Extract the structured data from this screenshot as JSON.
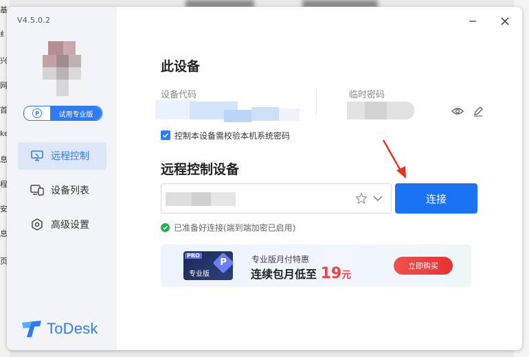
{
  "app": {
    "version": "V4.5.0.2",
    "brand": "ToDesk",
    "trial_badge": "试用专业版",
    "trial_badge_icon": "P"
  },
  "sidebar": {
    "items": [
      {
        "label": "远程控制",
        "icon": "monitor-icon",
        "active": true
      },
      {
        "label": "设备列表",
        "icon": "devices-icon",
        "active": false
      },
      {
        "label": "高级设置",
        "icon": "hexagon-settings-icon",
        "active": false
      }
    ]
  },
  "this_device": {
    "title": "此设备",
    "code_label": "设备代码",
    "password_label": "临时密码",
    "verify_checkbox_label": "控制本设备需校验本机系统密码",
    "verify_checked": true
  },
  "remote": {
    "title": "远程控制设备",
    "connect_label": "连接",
    "status_text": "已准备好连接(端到端加密已启用)"
  },
  "promo": {
    "card_tag": "PRO",
    "card_text": "专业版",
    "card_icon_letter": "P",
    "subtitle": "专业版月付特惠",
    "headline": "连续包月低至",
    "price": "19",
    "unit": "元",
    "buy_label": "立即购买"
  },
  "colors": {
    "accent": "#1a73f3",
    "promo_red": "#f04545",
    "success": "#22b14c"
  }
}
